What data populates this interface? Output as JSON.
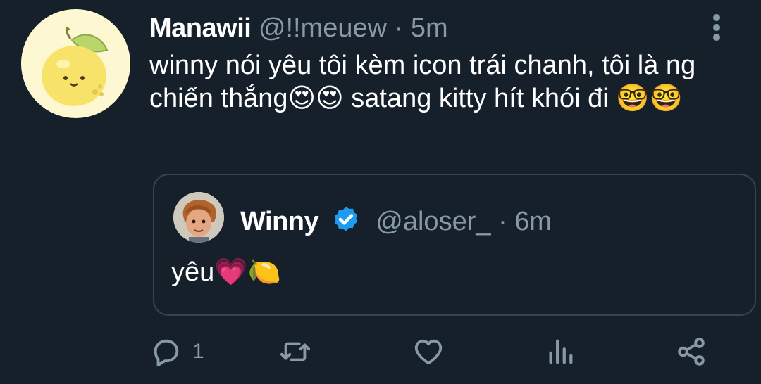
{
  "tweet": {
    "author": {
      "display_name": "Manawii",
      "handle": "@!!meuew",
      "separator": "·",
      "time": "5m",
      "avatar_icon": "lemon-avatar"
    },
    "more_icon": "vertical-ellipsis-icon",
    "text": "winny nói yêu tôi kèm icon trái chanh, tôi là ng chiến thắng😍😍 satang kitty hít khói đi 🤓🤓",
    "quoted": {
      "display_name": "Winny",
      "verified": true,
      "verified_icon": "verified-badge-icon",
      "handle": "@aloser_",
      "separator": "·",
      "time": "6m",
      "text": "yêu💗🍋",
      "avatar_icon": "cartoon-character-avatar"
    },
    "actions": {
      "reply_count": "1",
      "icons": [
        "reply-icon",
        "retweet-icon",
        "like-icon",
        "analytics-icon",
        "share-icon"
      ]
    }
  },
  "colors": {
    "background": "#15202b",
    "primary_text": "#ffffff",
    "secondary_text": "#8899a6",
    "border": "#38444d",
    "verified": "#1d9bf0"
  }
}
